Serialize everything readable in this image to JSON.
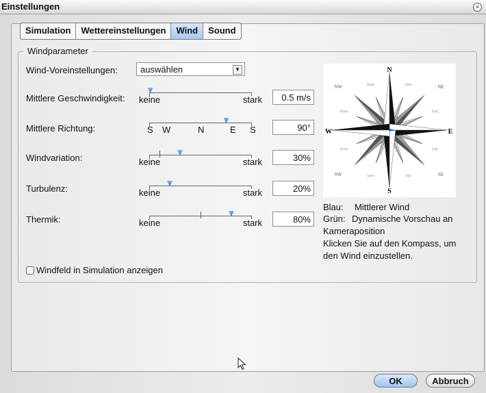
{
  "window": {
    "title": "Einstellungen",
    "close_symbol": "×"
  },
  "tabs": [
    {
      "label": "Simulation"
    },
    {
      "label": "Wettereinstellungen"
    },
    {
      "label": "Wind",
      "active": true
    },
    {
      "label": "Sound"
    }
  ],
  "group": {
    "title": "Windparameter",
    "preset": {
      "label": "Wind-Voreinstellungen:",
      "value": "auswählen"
    },
    "speed": {
      "label": "Mittlere Geschwindigkeit:",
      "min": "keine",
      "max": "stark",
      "value": "0.5 m/s",
      "level": 0.01
    },
    "direction": {
      "label": "Mittlere Richtung:",
      "ticks": [
        "S",
        "W",
        "N",
        "E",
        "S"
      ],
      "value": "90°",
      "degrees": 90
    },
    "variation": {
      "label": "Windvariation:",
      "min": "keine",
      "max": "stark",
      "value": "30%",
      "level": 0.3
    },
    "turbulence": {
      "label": "Turbulenz:",
      "min": "keine",
      "max": "stark",
      "value": "20%",
      "level": 0.2
    },
    "thermal": {
      "label": "Thermik:",
      "min": "keine",
      "max": "stark",
      "value": "80%",
      "level": 0.8
    },
    "compass": {
      "main": [
        "N",
        "E",
        "S",
        "W"
      ],
      "ordinal": [
        "NE",
        "SE",
        "SW",
        "NW"
      ],
      "minor": [
        "NNE",
        "ENE",
        "ESE",
        "SSE",
        "SSW",
        "WSW",
        "WNW",
        "NNW"
      ]
    },
    "info": {
      "blue_key": "Blau:",
      "blue_text": "Mittlerer Wind",
      "green_key": "Grün:",
      "green_text": "Dynamische Vorschau an",
      "green_text2": "Kameraposition",
      "hint1": "Klicken Sie auf den Kompass, um",
      "hint2": "den Wind einzustellen."
    },
    "show_field": {
      "label": "Windfeld in Simulation anzeigen",
      "checked": false
    }
  },
  "buttons": {
    "ok": "OK",
    "cancel": "Abbruch"
  },
  "colors": {
    "accent": "#2b70d0",
    "tab_active": "#a9c9f2"
  }
}
